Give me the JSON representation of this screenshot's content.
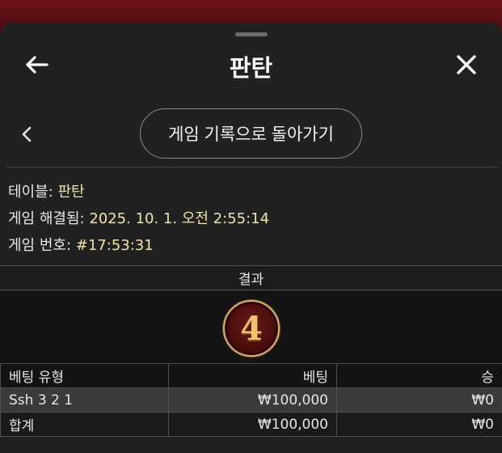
{
  "header": {
    "title": "판탄"
  },
  "subheader": {
    "history_button_label": "게임 기록으로 돌아가기"
  },
  "info": {
    "table_label": "테이블:",
    "table_value": "판탄",
    "resolved_label": "게임 해결됨:",
    "resolved_value": "2025. 10. 1. 오전 2:55:14",
    "game_number_label": "게임 번호:",
    "game_number_value": "#17:53:31"
  },
  "result": {
    "header": "결과",
    "value": "4"
  },
  "bets_table": {
    "columns": [
      "베팅 유형",
      "베팅",
      "승"
    ],
    "rows": [
      {
        "type": "Ssh 3 2 1",
        "bet": "₩100,000",
        "win": "₩0"
      }
    ],
    "total": {
      "label": "합계",
      "bet": "₩100,000",
      "win": "₩0"
    }
  },
  "icons": {
    "back": "arrow-left-icon",
    "close": "close-icon",
    "sub_back": "chevron-left-icon"
  },
  "colors": {
    "backdrop": "#5a1014",
    "sheet": "#212121",
    "value_text": "#f0e3a8",
    "ball_gold": "#f0c56a"
  }
}
